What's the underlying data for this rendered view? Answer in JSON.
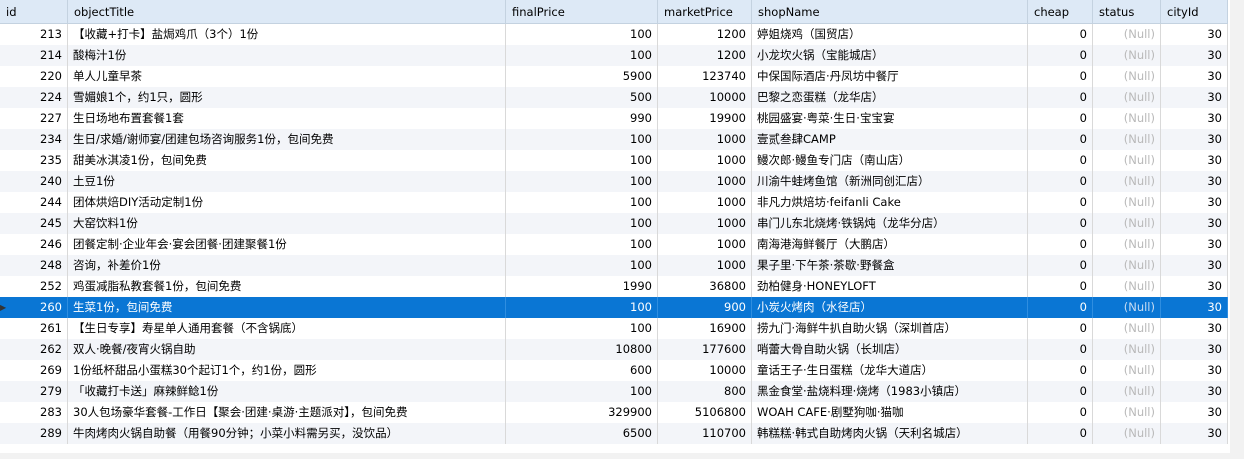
{
  "columns": [
    "id",
    "objectTitle",
    "finalPrice",
    "marketPrice",
    "shopName",
    "cheap",
    "status",
    "cityId"
  ],
  "selected_row_index": 13,
  "row_indicator_icon": "triangle-right-icon",
  "rows": [
    [
      "213",
      "【收藏+打卡】盐焗鸡爪（3个）1份",
      "100",
      "1200",
      "婷姐烧鸡（国贸店）",
      "0",
      "(Null)",
      "30"
    ],
    [
      "214",
      "酸梅汁1份",
      "100",
      "1200",
      "小龙坎火锅（宝能城店）",
      "0",
      "(Null)",
      "30"
    ],
    [
      "220",
      "单人儿童早茶",
      "5900",
      "123740",
      "中保国际酒店·丹凤坊中餐厅",
      "0",
      "(Null)",
      "30"
    ],
    [
      "224",
      "雪媚娘1个，约1只，圆形",
      "500",
      "10000",
      "巴黎之恋蛋糕（龙华店）",
      "0",
      "(Null)",
      "30"
    ],
    [
      "227",
      "生日场地布置套餐1套",
      "990",
      "19900",
      "桃园盛宴·粤菜·生日·宝宝宴",
      "0",
      "(Null)",
      "30"
    ],
    [
      "234",
      "生日/求婚/谢师宴/团建包场咨询服务1份，包间免费",
      "100",
      "1000",
      "壹贰叁肆CAMP",
      "0",
      "(Null)",
      "30"
    ],
    [
      "235",
      "甜美冰淇凌1份，包间免费",
      "100",
      "1000",
      "鳗次郎·鳗鱼专门店（南山店）",
      "0",
      "(Null)",
      "30"
    ],
    [
      "240",
      "土豆1份",
      "100",
      "1000",
      "川渝牛蛙烤鱼馆（新洲同创汇店）",
      "0",
      "(Null)",
      "30"
    ],
    [
      "244",
      "团体烘焙DIY活动定制1份",
      "100",
      "1000",
      "非凡力烘焙坊·feifanli Cake",
      "0",
      "(Null)",
      "30"
    ],
    [
      "245",
      "大窑饮料1份",
      "100",
      "1000",
      "串门儿东北烧烤·铁锅炖（龙华分店）",
      "0",
      "(Null)",
      "30"
    ],
    [
      "246",
      "团餐定制·企业年会·宴会团餐·团建聚餐1份",
      "100",
      "1000",
      "南海港海鲜餐厅（大鹏店）",
      "0",
      "(Null)",
      "30"
    ],
    [
      "248",
      "咨询，补差价1份",
      "100",
      "1000",
      "果子里·下午茶·茶歇·野餐盒",
      "0",
      "(Null)",
      "30"
    ],
    [
      "252",
      "鸡蛋减脂私教套餐1份，包间免费",
      "1990",
      "36800",
      "劲柏健身·HONEYLOFT",
      "0",
      "(Null)",
      "30"
    ],
    [
      "260",
      "生菜1份，包间免费",
      "100",
      "900",
      "小炭火烤肉（水径店）",
      "0",
      "(Null)",
      "30"
    ],
    [
      "261",
      "【生日专享】寿星单人通用套餐（不含锅底）",
      "100",
      "16900",
      "捞九门·海鲜牛扒自助火锅（深圳首店）",
      "0",
      "(Null)",
      "30"
    ],
    [
      "262",
      "双人·晚餐/夜宵火锅自助",
      "10800",
      "177600",
      "哨蕾大骨自助火锅（长圳店）",
      "0",
      "(Null)",
      "30"
    ],
    [
      "269",
      "1份纸杯甜品小蛋糕30个起订1个，约1份，圆形",
      "600",
      "10000",
      "童话王子·生日蛋糕（龙华大道店）",
      "0",
      "(Null)",
      "30"
    ],
    [
      "279",
      "「收藏打卡送」麻辣鲜鲶1份",
      "100",
      "800",
      "黑金食堂·盐烧料理·烧烤（1983小镇店）",
      "0",
      "(Null)",
      "30"
    ],
    [
      "283",
      "30人包场豪华套餐-工作日【聚会·团建·桌游·主题派对】，包间免费",
      "329900",
      "5106800",
      "WOAH CAFE·剧墅狗咖·猫咖",
      "0",
      "(Null)",
      "30"
    ],
    [
      "289",
      "牛肉烤肉火锅自助餐（用餐90分钟；小菜小料需另买，没饮品）",
      "6500",
      "110700",
      "韩糕糕·韩式自助烤肉火锅（天利名城店）",
      "0",
      "(Null)",
      "30"
    ]
  ]
}
